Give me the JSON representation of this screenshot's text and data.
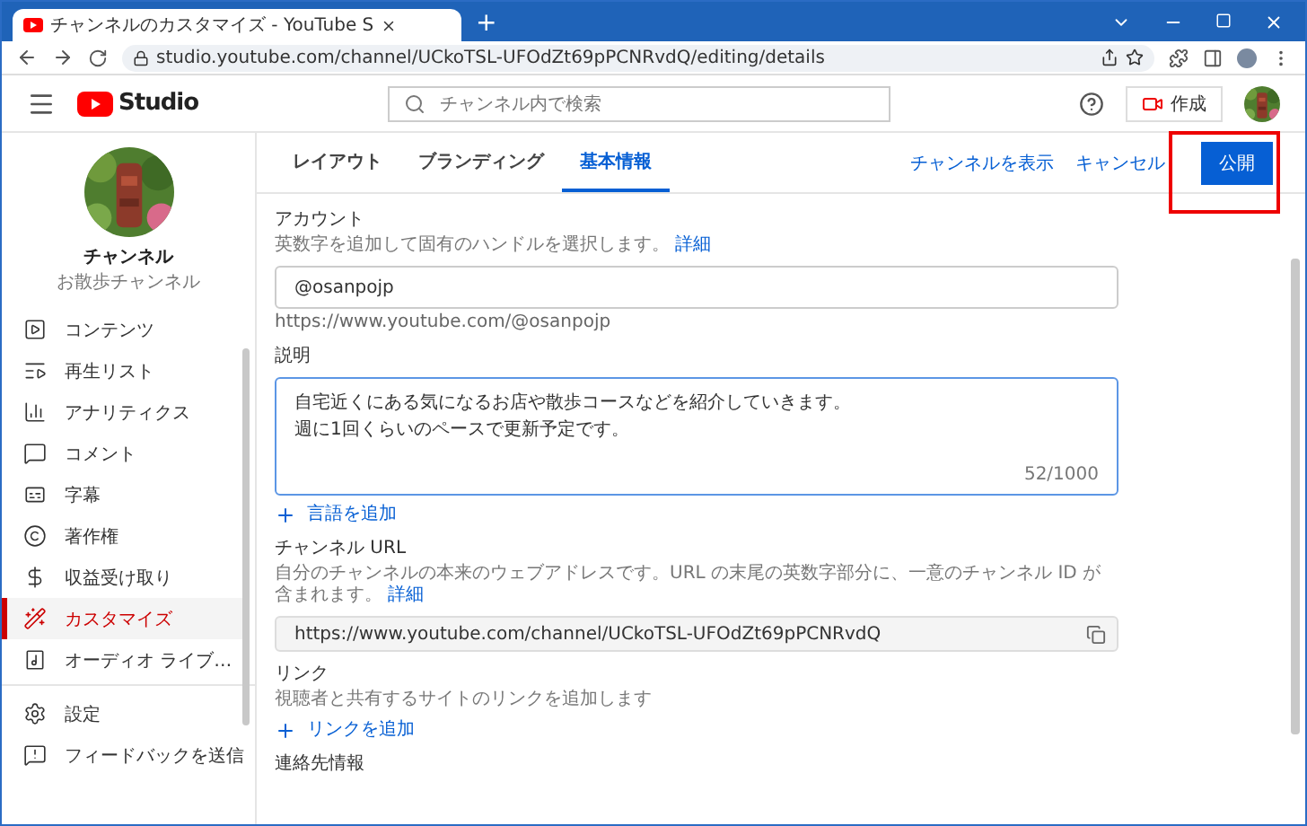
{
  "browser": {
    "tab_title": "チャンネルのカスタマイズ - YouTube S",
    "new_tab": "+",
    "url": "studio.youtube.com/channel/UCkoTSL-UFOdZt69pPCNRvdQ/editing/details"
  },
  "header": {
    "logo": "Studio",
    "search": {
      "placeholder": "チャンネル内で検索"
    },
    "create_button": "作成"
  },
  "channel": {
    "name": "チャンネル",
    "subtitle": "お散歩チャンネル"
  },
  "nav_items": [
    {
      "label": "コンテンツ",
      "kind": "content",
      "selected": false
    },
    {
      "label": "再生リスト",
      "kind": "playlist",
      "selected": false
    },
    {
      "label": "アナリティクス",
      "kind": "analytics",
      "selected": false
    },
    {
      "label": "コメント",
      "kind": "comments",
      "selected": false
    },
    {
      "label": "字幕",
      "kind": "subtitles",
      "selected": false
    },
    {
      "label": "著作権",
      "kind": "copyright",
      "selected": false
    },
    {
      "label": "収益受け取り",
      "kind": "earn",
      "selected": false
    },
    {
      "label": "カスタマイズ",
      "kind": "customize",
      "selected": true
    },
    {
      "label": "オーディオ ライブ…",
      "kind": "audio",
      "selected": false
    }
  ],
  "footer_nav": [
    {
      "label": "設定",
      "kind": "settings"
    },
    {
      "label": "フィードバックを送信",
      "kind": "feedback"
    }
  ],
  "tabs": [
    {
      "label": "レイアウト",
      "selected": false
    },
    {
      "label": "ブランディング",
      "selected": false
    },
    {
      "label": "基本情報",
      "selected": true
    }
  ],
  "actions": {
    "view_channel": "チャンネルを表示",
    "cancel": "キャンセル",
    "publish": "公開",
    "publish_highlighted": true
  },
  "account": {
    "title": "アカウント",
    "description": "英数字を追加して固有のハンドルを選択します。",
    "details_link": "詳細",
    "handle": "@osanpojp",
    "handle_url": "https://www.youtube.com/@osanpojp"
  },
  "description": {
    "title": "説明",
    "lines": [
      "自宅近くにある気になるお店や散歩コースなどを紹介していきます。",
      "週に1回くらいのペースで更新予定です。"
    ],
    "counter": "52/1000",
    "add_language": "言語を追加"
  },
  "channel_url": {
    "title": "チャンネル URL",
    "description": "自分のチャンネルの本来のウェブアドレスです。URL の末尾の英数字部分に、一意のチャンネル ID が含まれます。",
    "details_link": "詳細",
    "url": "https://www.youtube.com/channel/UCkoTSL-UFOdZt69pPCNRvdQ"
  },
  "links": {
    "title": "リンク",
    "description": "視聴者と共有するサイトのリンクを追加します",
    "add_link": "リンクを追加"
  },
  "contact": {
    "title": "連絡先情報"
  }
}
